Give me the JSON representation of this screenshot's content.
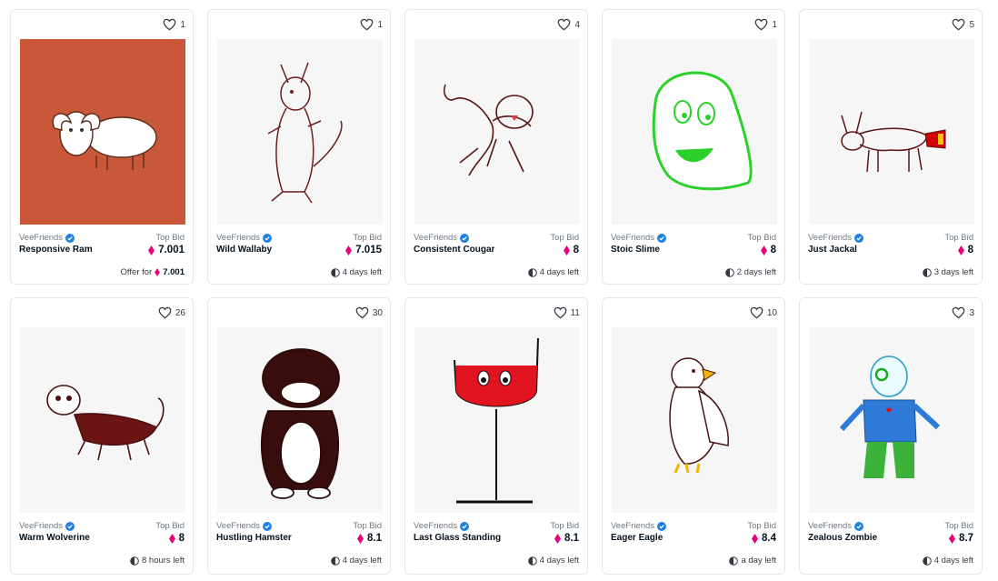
{
  "colors": {
    "eth": "#e6007a",
    "verified": "#2081e2"
  },
  "icons": {
    "like": "heart-icon",
    "verified": "verified-badge-icon",
    "currency": "eth-icon",
    "time": "clock-icon"
  },
  "cards": [
    {
      "likes": "1",
      "collection": "VeeFriends",
      "top_bid_label": "Top Bid",
      "name": "Responsive Ram",
      "price": "7.001",
      "footer_label": "Offer for",
      "footer_price": "7.001"
    },
    {
      "likes": "1",
      "collection": "VeeFriends",
      "top_bid_label": "Top Bid",
      "name": "Wild Wallaby",
      "price": "7.015",
      "footer": "4 days left"
    },
    {
      "likes": "4",
      "collection": "VeeFriends",
      "top_bid_label": "Top Bid",
      "name": "Consistent Cougar",
      "price": "8",
      "footer": "4 days left"
    },
    {
      "likes": "1",
      "collection": "VeeFriends",
      "top_bid_label": "Top Bid",
      "name": "Stoic Slime",
      "price": "8",
      "footer": "2 days left"
    },
    {
      "likes": "5",
      "collection": "VeeFriends",
      "top_bid_label": "Top Bid",
      "name": "Just Jackal",
      "price": "8",
      "footer": "3 days left"
    },
    {
      "likes": "26",
      "collection": "VeeFriends",
      "top_bid_label": "Top Bid",
      "name": "Warm Wolverine",
      "price": "8",
      "footer": "8 hours left"
    },
    {
      "likes": "30",
      "collection": "VeeFriends",
      "top_bid_label": "Top Bid",
      "name": "Hustling Hamster",
      "price": "8.1",
      "footer": "4 days left"
    },
    {
      "likes": "11",
      "collection": "VeeFriends",
      "top_bid_label": "Top Bid",
      "name": "Last Glass Standing",
      "price": "8.1",
      "footer": "4 days left"
    },
    {
      "likes": "10",
      "collection": "VeeFriends",
      "top_bid_label": "Top Bid",
      "name": "Eager Eagle",
      "price": "8.4",
      "footer": "a day left"
    },
    {
      "likes": "3",
      "collection": "VeeFriends",
      "top_bid_label": "Top Bid",
      "name": "Zealous Zombie",
      "price": "8.7",
      "footer": "4 days left"
    }
  ]
}
